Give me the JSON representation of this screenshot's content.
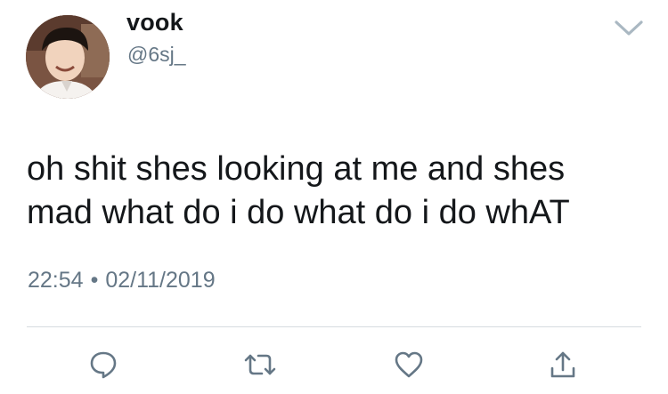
{
  "tweet": {
    "author": {
      "name": "vook",
      "handle": "@6sj_"
    },
    "text": "oh shit shes looking at me and shes\nmad what do i do what do i do whAT",
    "time": "22:54",
    "separator": "•",
    "date": "02/11/2019"
  },
  "icons": {
    "caret": "chevron-down-icon",
    "reply": "reply-icon",
    "retweet": "retweet-icon",
    "like": "heart-icon",
    "share": "share-icon"
  },
  "colors": {
    "text": "#14171a",
    "secondary": "#657786",
    "divider": "#d6dbdf",
    "icon": "#657786"
  }
}
